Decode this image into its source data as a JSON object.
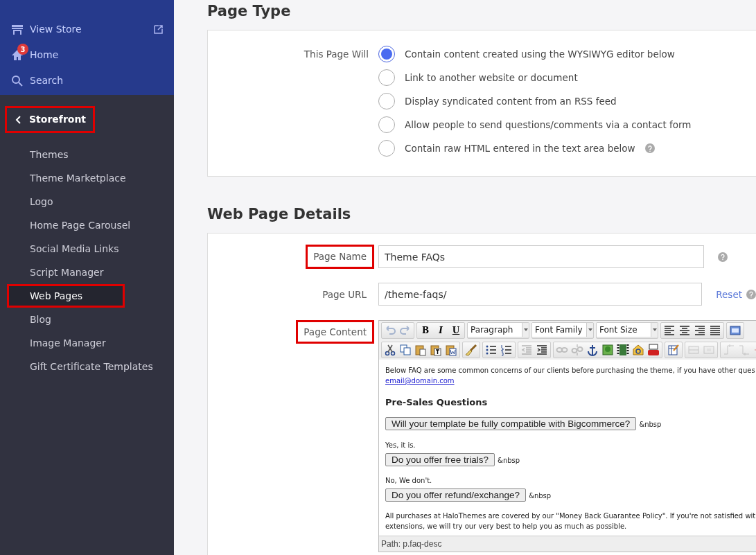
{
  "sidebar": {
    "top_items": [
      {
        "label": "View Store",
        "external": true
      },
      {
        "label": "Home",
        "external": false,
        "badge": "3"
      },
      {
        "label": "Search",
        "external": false
      }
    ],
    "section": {
      "label": "Storefront",
      "highlighted": true
    },
    "items": [
      {
        "label": "Themes",
        "selected": false,
        "highlighted": false
      },
      {
        "label": "Theme Marketplace",
        "selected": false,
        "highlighted": false
      },
      {
        "label": "Logo",
        "selected": false,
        "highlighted": false
      },
      {
        "label": "Home Page Carousel",
        "selected": false,
        "highlighted": false
      },
      {
        "label": "Social Media Links",
        "selected": false,
        "highlighted": false
      },
      {
        "label": "Script Manager",
        "selected": false,
        "highlighted": false
      },
      {
        "label": "Web Pages",
        "selected": true,
        "highlighted": true
      },
      {
        "label": "Blog",
        "selected": false,
        "highlighted": false
      },
      {
        "label": "Image Manager",
        "selected": false,
        "highlighted": false
      },
      {
        "label": "Gift Certificate Templates",
        "selected": false,
        "highlighted": false
      }
    ]
  },
  "page_type": {
    "title": "Page Type",
    "label": "This Page Will",
    "options": [
      {
        "label": "Contain content created using the WYSIWYG editor below",
        "selected": true,
        "help": false
      },
      {
        "label": "Link to another website or document",
        "selected": false,
        "help": false
      },
      {
        "label": "Display syndicated content from an RSS feed",
        "selected": false,
        "help": false
      },
      {
        "label": "Allow people to send questions/comments via a contact form",
        "selected": false,
        "help": false
      },
      {
        "label": "Contain raw HTML entered in the text area below",
        "selected": false,
        "help": true
      }
    ]
  },
  "details": {
    "title": "Web Page Details",
    "page_name": {
      "label": "Page Name",
      "value": "Theme FAQs",
      "highlighted": true
    },
    "page_url": {
      "label": "Page URL",
      "value": "/theme-faqs/",
      "highlighted": false,
      "link": "Reset"
    },
    "page_content": {
      "label": "Page Content",
      "highlighted": true,
      "toolbar_rows": [
        [
          [
            {
              "kind": "icon",
              "disabled": true
            },
            {
              "kind": "icon",
              "disabled": true
            }
          ],
          [
            {
              "kind": "letter",
              "label": "B",
              "disabled": false
            },
            {
              "kind": "letter",
              "label": "I",
              "disabled": false
            },
            {
              "kind": "letter",
              "label": "U",
              "disabled": false
            }
          ],
          [
            {
              "kind": "select",
              "label": "Paragraph"
            }
          ],
          [
            {
              "kind": "select",
              "label": "Font Family"
            }
          ],
          [
            {
              "kind": "select",
              "label": "Font Size"
            }
          ],
          [
            {
              "kind": "icon",
              "disabled": false
            },
            {
              "kind": "icon",
              "disabled": false
            },
            {
              "kind": "icon",
              "disabled": false
            },
            {
              "kind": "icon",
              "disabled": false
            }
          ],
          [
            {
              "kind": "icon",
              "disabled": false
            }
          ]
        ],
        [
          [
            {
              "kind": "icon",
              "disabled": false
            },
            {
              "kind": "icon",
              "disabled": false
            },
            {
              "kind": "icon",
              "disabled": false
            },
            {
              "kind": "icon",
              "disabled": false
            },
            {
              "kind": "icon",
              "disabled": false
            }
          ],
          [
            {
              "kind": "icon",
              "disabled": false
            }
          ],
          [
            {
              "kind": "icon",
              "disabled": false
            },
            {
              "kind": "icon",
              "disabled": false
            }
          ],
          [
            {
              "kind": "icon",
              "disabled": true
            },
            {
              "kind": "icon",
              "disabled": false
            }
          ],
          [
            {
              "kind": "icon",
              "disabled": true
            },
            {
              "kind": "icon",
              "disabled": true
            },
            {
              "kind": "icon",
              "disabled": false
            },
            {
              "kind": "icon",
              "disabled": false
            },
            {
              "kind": "icon",
              "disabled": false
            },
            {
              "kind": "icon",
              "disabled": false
            },
            {
              "kind": "icon",
              "disabled": false
            }
          ],
          [
            {
              "kind": "icon",
              "disabled": false
            }
          ],
          [
            {
              "kind": "icon",
              "disabled": true
            },
            {
              "kind": "icon",
              "disabled": true
            }
          ],
          [
            {
              "kind": "icon",
              "disabled": true
            },
            {
              "kind": "icon",
              "disabled": true
            },
            {
              "kind": "icon",
              "disabled": true
            }
          ]
        ]
      ],
      "content": [
        {
          "kind": "intro",
          "text": "Below FAQ are some common concerns of our clients before purchasing the theme, if you have other ques",
          "link": "email@domain.com"
        },
        {
          "kind": "heading",
          "text": "Pre-Sales Questions"
        },
        {
          "kind": "question",
          "text": "Will your template be fully compatible with Bigcommerce?",
          "suffix": "&nbsp"
        },
        {
          "kind": "answer",
          "text": "Yes, it is."
        },
        {
          "kind": "question",
          "text": "Do you offer free trials?",
          "suffix": "&nbsp"
        },
        {
          "kind": "answer",
          "text": "No, We don't."
        },
        {
          "kind": "question",
          "text": "Do you offer refund/exchange?",
          "suffix": "&nbsp"
        },
        {
          "kind": "answer",
          "text": "All purchases at HaloThemes are covered by our \"Money Back Guarantee Policy\". If you're not satisfied wit extensions, we will try our very best to help you as much as possible."
        }
      ],
      "path": "Path: p.faq-desc"
    }
  }
}
